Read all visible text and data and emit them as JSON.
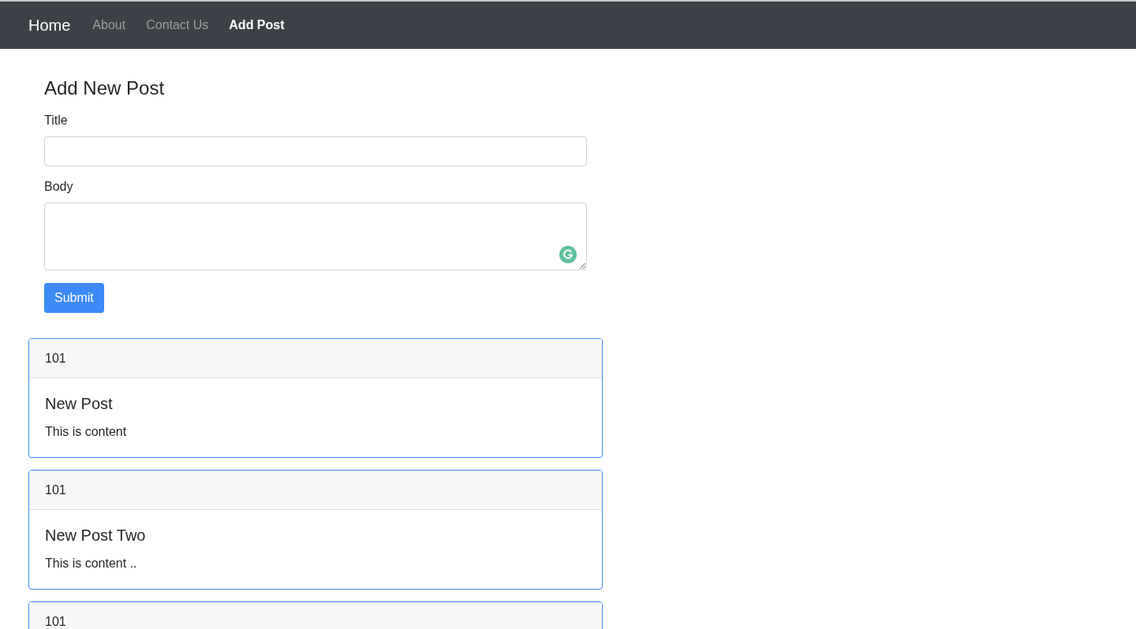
{
  "navbar": {
    "brand": "Home",
    "links": [
      {
        "label": "About",
        "selected": false
      },
      {
        "label": "Contact Us",
        "selected": false
      },
      {
        "label": "Add Post",
        "selected": true
      }
    ]
  },
  "form": {
    "heading": "Add New Post",
    "fields": [
      {
        "kind": "input",
        "label": "Title"
      },
      {
        "kind": "textarea",
        "label": "Body"
      }
    ],
    "submit": "Submit"
  },
  "posts": [
    {
      "header": "101",
      "title": "New Post",
      "body": "This is content"
    },
    {
      "header": "101",
      "title": "New Post Two",
      "body": "This is content .."
    },
    {
      "header": "101"
    }
  ]
}
